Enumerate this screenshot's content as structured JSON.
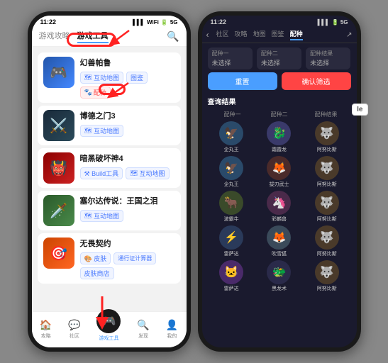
{
  "left_phone": {
    "status_time": "11:22",
    "status_signal": "5G",
    "nav_tabs": [
      "游戏攻略",
      "游戏工具"
    ],
    "active_tab": "游戏工具",
    "search_icon": "🔍",
    "games": [
      {
        "title": "幻兽帕鲁",
        "tags": [
          "互动地图",
          "图鉴",
          "配种"
        ],
        "thumb_color": "thumb-blue",
        "emoji": "🎮"
      },
      {
        "title": "博德之门3",
        "tags": [
          "互动地图"
        ],
        "thumb_color": "thumb-dark",
        "emoji": "⚔️"
      },
      {
        "title": "暗黑破坏神4",
        "tags": [
          "Build工具",
          "互动地图"
        ],
        "thumb_color": "thumb-red",
        "emoji": "👹"
      },
      {
        "title": "塞尔达传说：王国之泪",
        "tags": [
          "互动地图"
        ],
        "thumb_color": "thumb-green",
        "emoji": "🗡️"
      },
      {
        "title": "无畏契约",
        "tags": [
          "皮肤",
          "通行证计算器",
          "皮肤商店"
        ],
        "thumb_color": "thumb-orange",
        "emoji": "🎯"
      }
    ],
    "bottom_nav": [
      "攻略",
      "社区",
      "游戏工具",
      "发现",
      "我的"
    ]
  },
  "right_phone": {
    "status_time": "11:22",
    "nav_tabs": [
      "社区",
      "攻略",
      "地图",
      "图鉴",
      "配种"
    ],
    "active_tab": "配种",
    "breed_labels": [
      "配种一",
      "配种二",
      "配种结果"
    ],
    "breed_placeholder": "未选择",
    "btn_reset": "重置",
    "btn_confirm": "确认筛选",
    "results_title": "查询结果",
    "results_headers": [
      "配种一",
      "配种二",
      "配种结果"
    ],
    "results": [
      {
        "p1": {
          "name": "企丸王",
          "emoji": "🦅",
          "bg": "#2a4a6a"
        },
        "p2": {
          "name": "霜霞龙",
          "emoji": "🐉",
          "bg": "#3a3a6a"
        },
        "child": {
          "name": "阿努比斯",
          "emoji": "🐺",
          "bg": "#4a3a2a"
        }
      },
      {
        "p1": {
          "name": "企丸王",
          "emoji": "🦅",
          "bg": "#2a4a6a"
        },
        "p2": {
          "name": "拔刃武士",
          "emoji": "🦊",
          "bg": "#4a2a2a"
        },
        "child": {
          "name": "阿努比斯",
          "emoji": "🐺",
          "bg": "#4a3a2a"
        }
      },
      {
        "p1": {
          "name": "波霸牛",
          "emoji": "🐂",
          "bg": "#3a4a2a"
        },
        "p2": {
          "name": "彩麟兽",
          "emoji": "🦄",
          "bg": "#4a2a4a"
        },
        "child": {
          "name": "阿努比斯",
          "emoji": "🐺",
          "bg": "#4a3a2a"
        }
      },
      {
        "p1": {
          "name": "雷萨达",
          "emoji": "⚡",
          "bg": "#2a3a5a"
        },
        "p2": {
          "name": "吹雪狐",
          "emoji": "🦊",
          "bg": "#3a4a5a"
        },
        "child": {
          "name": "阿努比斯",
          "emoji": "🐺",
          "bg": "#4a3a2a"
        }
      },
      {
        "p1": {
          "name": "雷萨达",
          "emoji": "🐱",
          "bg": "#4a2a6a"
        },
        "p2": {
          "name": "黑龙术",
          "emoji": "🐲",
          "bg": "#2a2a4a"
        },
        "child": {
          "name": "阿努比斯",
          "emoji": "🐺",
          "bg": "#4a3a2a"
        }
      }
    ]
  },
  "ie_label": "Ie"
}
